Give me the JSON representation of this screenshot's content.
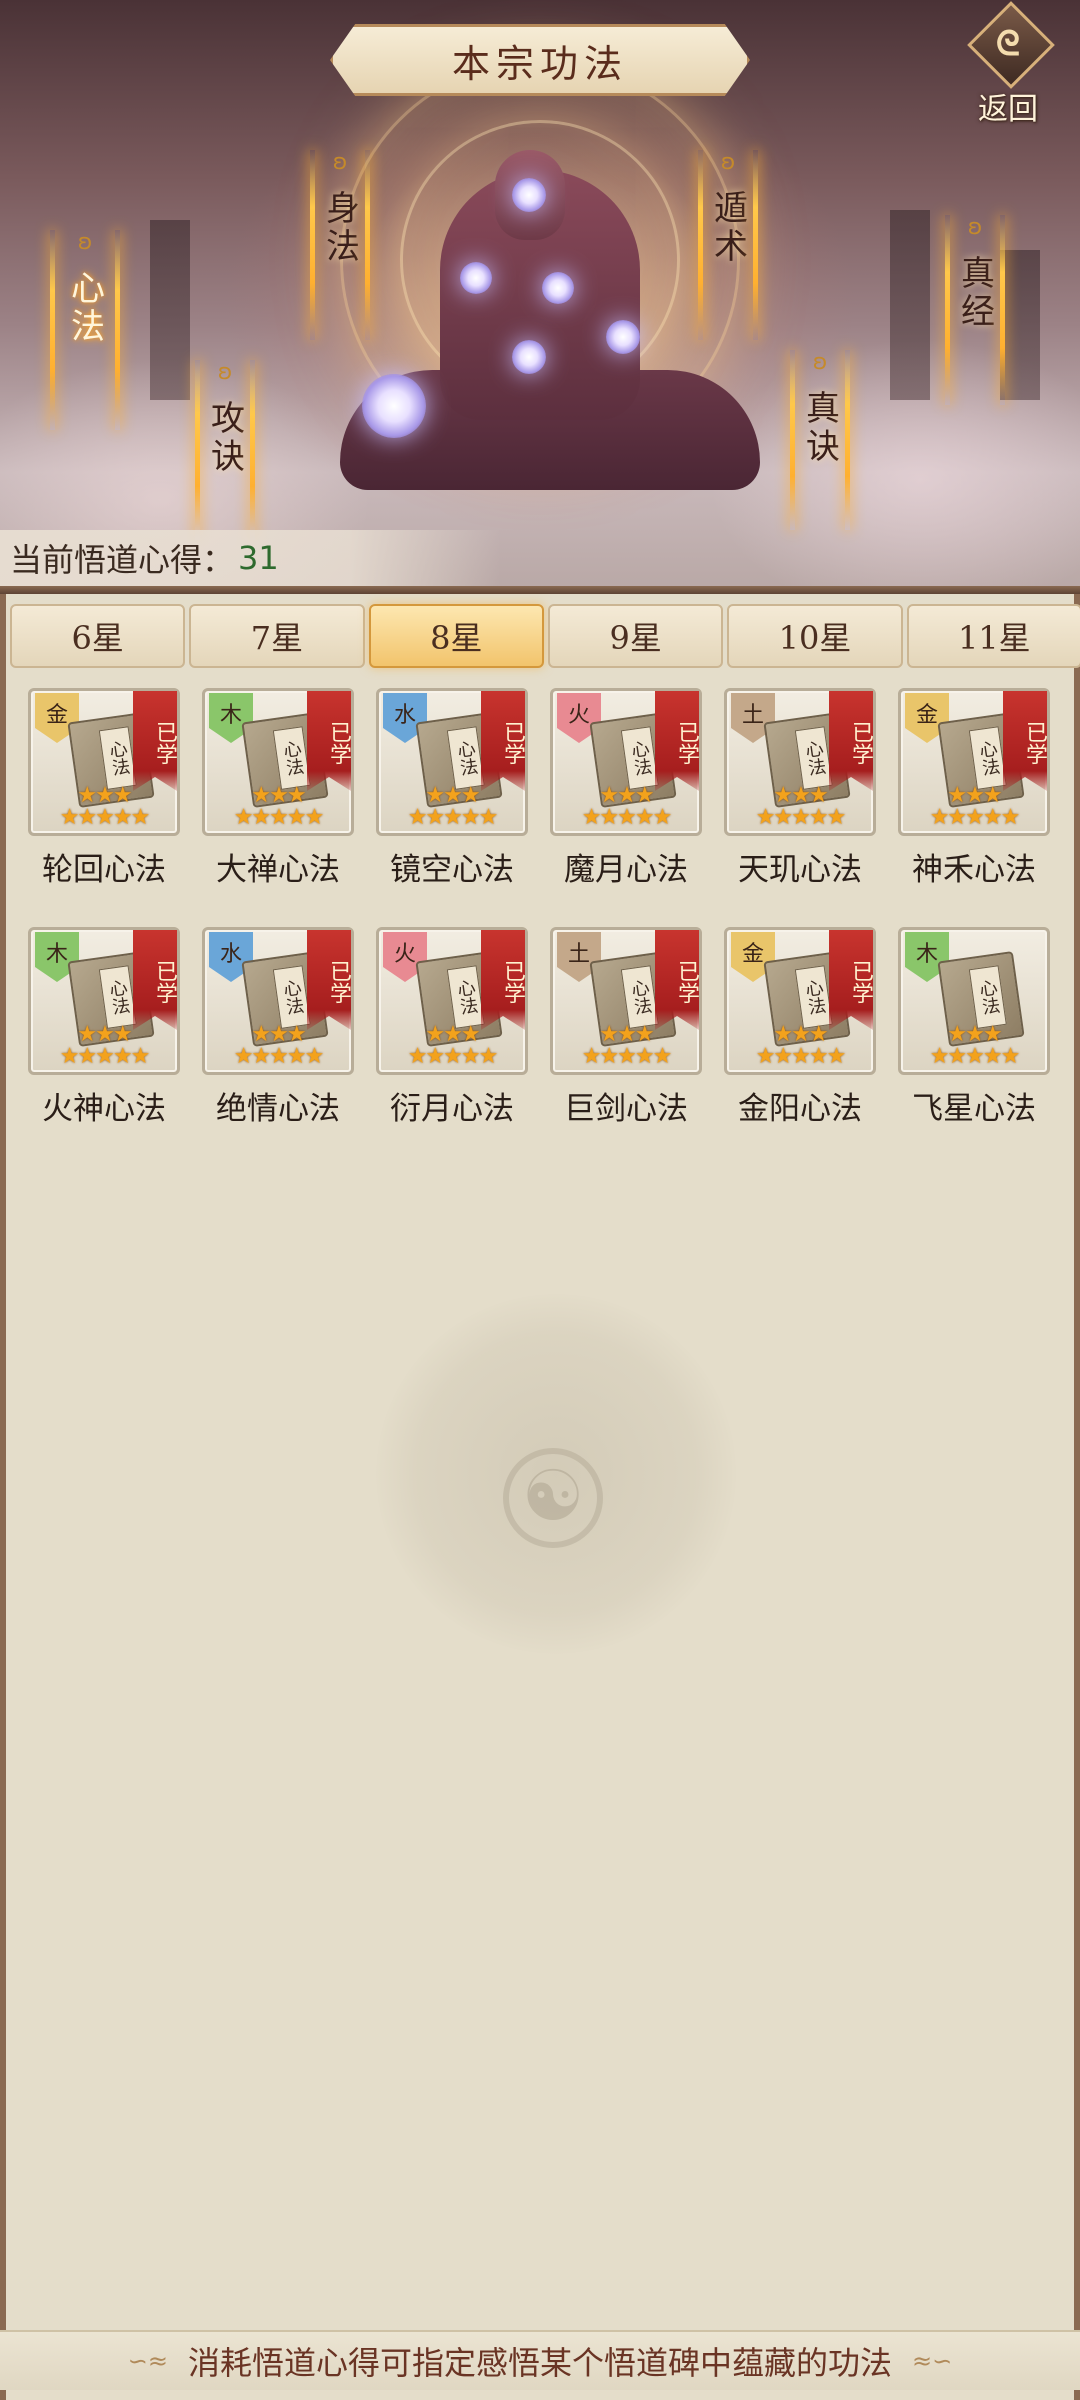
{
  "header": {
    "title": "本宗功法",
    "back_label": "返回"
  },
  "skill_types": [
    {
      "label": "心法",
      "active": true
    },
    {
      "label": "身法",
      "active": false
    },
    {
      "label": "攻诀",
      "active": false
    },
    {
      "label": "遁术",
      "active": false
    },
    {
      "label": "真诀",
      "active": false
    },
    {
      "label": "真经",
      "active": false
    }
  ],
  "insight": {
    "label": "当前悟道心得：",
    "value": "31"
  },
  "tabs": [
    {
      "label": "6星",
      "selected": false
    },
    {
      "label": "7星",
      "selected": false
    },
    {
      "label": "8星",
      "selected": true
    },
    {
      "label": "9星",
      "selected": false
    },
    {
      "label": "10星",
      "selected": false
    },
    {
      "label": "11星",
      "selected": false
    }
  ],
  "book_label": "心法",
  "learned_label": "已学",
  "stars_top": "★★★",
  "stars_bottom": "★★★★★",
  "element_colors": {
    "金": "#e9c56a",
    "木": "#8ac66a",
    "水": "#6aa6d8",
    "火": "#e88a92",
    "土": "#c4a88a"
  },
  "items": [
    {
      "name": "轮回心法",
      "element": "金",
      "learned": true
    },
    {
      "name": "大禅心法",
      "element": "木",
      "learned": true
    },
    {
      "name": "镜空心法",
      "element": "水",
      "learned": true
    },
    {
      "name": "魔月心法",
      "element": "火",
      "learned": true
    },
    {
      "name": "天玑心法",
      "element": "土",
      "learned": true
    },
    {
      "name": "神禾心法",
      "element": "金",
      "learned": true
    },
    {
      "name": "火神心法",
      "element": "木",
      "learned": true
    },
    {
      "name": "绝情心法",
      "element": "水",
      "learned": true
    },
    {
      "name": "衍月心法",
      "element": "火",
      "learned": true
    },
    {
      "name": "巨剑心法",
      "element": "土",
      "learned": true
    },
    {
      "name": "金阳心法",
      "element": "金",
      "learned": true
    },
    {
      "name": "飞星心法",
      "element": "木",
      "learned": false
    }
  ],
  "footer": {
    "text": "消耗悟道心得可指定感悟某个悟道碑中蕴藏的功法"
  }
}
